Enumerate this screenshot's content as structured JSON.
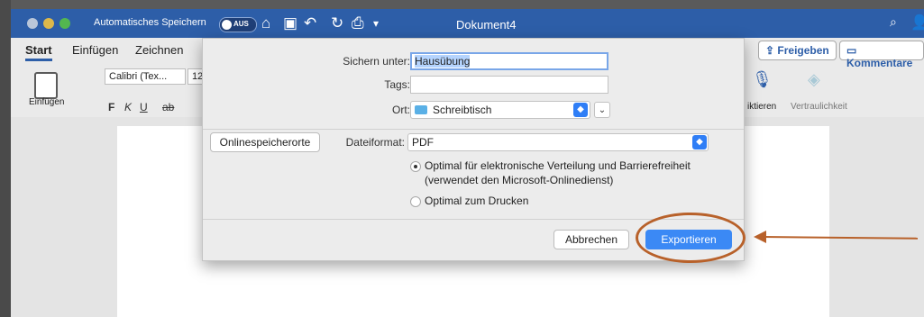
{
  "titlebar": {
    "autosave_label": "Automatisches Speichern",
    "autosave_toggle": "AUS",
    "document_title": "Dokument4",
    "icons": [
      "home-icon",
      "save-icon",
      "undo-icon",
      "redo-icon",
      "print-icon",
      "customize-icon"
    ]
  },
  "ribbon": {
    "tabs": [
      "Start",
      "Einfügen",
      "Zeichnen"
    ],
    "share_label": "Freigeben",
    "comments_label": "Kommentare",
    "paste_label": "Einfügen",
    "font_name": "Calibri (Tex...",
    "font_size": "12",
    "format_buttons": [
      "F",
      "K",
      "U",
      "ab"
    ],
    "dictate_label": "iktieren",
    "sensitivity_label": "Vertraulichkeit"
  },
  "dialog": {
    "save_as_label": "Sichern unter:",
    "save_as_value": "Hausübung",
    "tags_label": "Tags:",
    "tags_value": "",
    "location_label": "Ort:",
    "location_value": "Schreibtisch",
    "online_locations_button": "Onlinespeicherorte",
    "file_format_label": "Dateiformat:",
    "file_format_value": "PDF",
    "option_1_line1": "Optimal für elektronische Verteilung und Barrierefreiheit",
    "option_1_line2": "(verwendet den Microsoft-Onlinedienst)",
    "option_1_selected": true,
    "option_2": "Optimal zum Drucken",
    "option_2_selected": false,
    "cancel_label": "Abbrechen",
    "export_label": "Exportieren"
  },
  "colors": {
    "titlebar": "#2d5ea8",
    "primary_button": "#3b89f5",
    "annotation": "#b8612a"
  }
}
